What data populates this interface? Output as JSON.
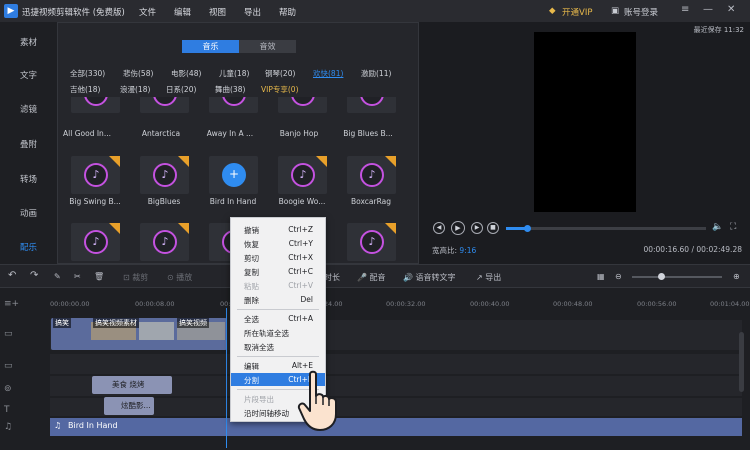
{
  "app": {
    "title": "迅捷视频剪辑软件 (免费版)",
    "menus": [
      "文件",
      "编辑",
      "视图",
      "导出",
      "帮助"
    ],
    "vip": "开通VIP",
    "login": "账号登录"
  },
  "sidebar": {
    "items": [
      "素材",
      "文字",
      "滤镜",
      "叠附",
      "转场",
      "动画",
      "配乐"
    ],
    "active": "配乐"
  },
  "library": {
    "tabs": [
      "音乐",
      "音效"
    ],
    "categories_row1": [
      "全部(330)",
      "悲伤(58)",
      "电影(48)",
      "儿童(18)",
      "钢琴(20)",
      "欢快(81)",
      "激励(11)"
    ],
    "categories_row2": [
      "吉他(18)",
      "浪漫(18)",
      "日系(20)",
      "舞曲(38)",
      "VIP专享(0)"
    ],
    "row1_labels": [
      "All Good In...",
      "Antarctica",
      "Away In A ...",
      "Banjo Hop",
      "Big Blues B..."
    ],
    "row2_labels": [
      "Big Swing B...",
      "BigBlues",
      "Bird In Hand",
      "Boogie Wo...",
      "BoxcarRag"
    ]
  },
  "preview": {
    "saved": "最近保存 11:32",
    "ratio_label": "宽高比:",
    "ratio_value": "9:16",
    "time": "00:00:16.60 / 00:02:49.28"
  },
  "toolbar": {
    "crop": "裁剪",
    "speed": "播放",
    "duration": "时长",
    "dub": "配音",
    "tts": "语音转文字",
    "export": "导出"
  },
  "timeline": {
    "ruler": [
      "00:00:00.00",
      "00:00:08.00",
      "00:00:16.00",
      "00:00:24.00",
      "00:00:32.00",
      "00:00:40.00",
      "00:00:48.00",
      "00:00:56.00",
      "00:01:04.00"
    ],
    "video_labels": [
      "搞笑",
      "搞笑视频素材",
      "搞笑视频"
    ],
    "text_clip_1": "美食 烧烤",
    "text_clip_2": "炫酷影...",
    "audio_clip": "Bird In Hand"
  },
  "context_menu": {
    "items": [
      {
        "label": "撤销",
        "key": "Ctrl+Z"
      },
      {
        "label": "恢复",
        "key": "Ctrl+Y"
      },
      {
        "label": "剪切",
        "key": "Ctrl+X"
      },
      {
        "label": "复制",
        "key": "Ctrl+C"
      },
      {
        "label": "粘贴",
        "key": "Ctrl+V"
      },
      {
        "label": "删除",
        "key": "Del"
      },
      {
        "label": "全选",
        "key": "Ctrl+A"
      },
      {
        "label": "所在轨道全选",
        "key": ""
      },
      {
        "label": "取消全选",
        "key": ""
      },
      {
        "label": "编辑",
        "key": "Alt+E"
      },
      {
        "label": "分割",
        "key": "Ctrl+B"
      },
      {
        "label": "片段导出",
        "key": ""
      },
      {
        "label": "沿时间轴移动",
        "key": ""
      }
    ]
  },
  "colors": {
    "accent": "#2f8cf0",
    "vip": "#e8b94b",
    "ring": "#c452e0",
    "highlight": "#2f7de1"
  }
}
